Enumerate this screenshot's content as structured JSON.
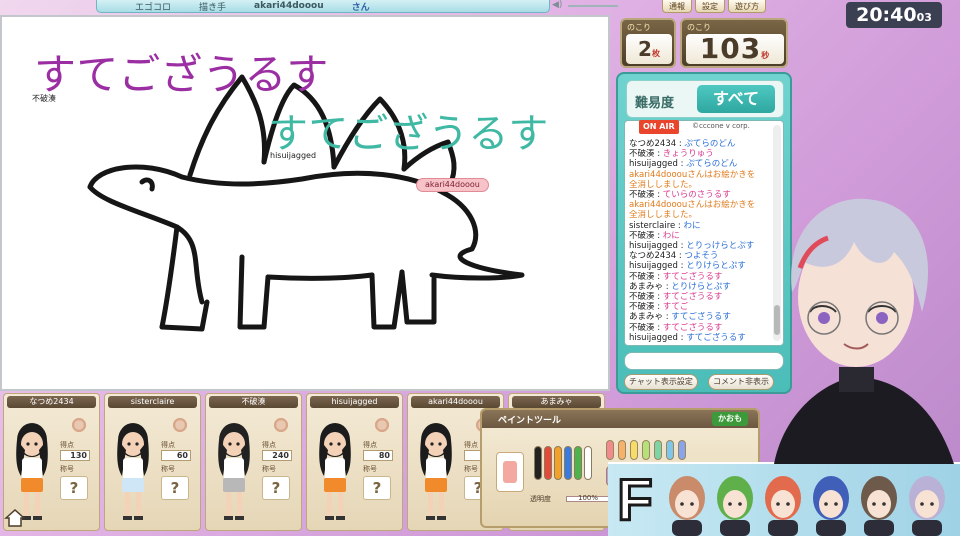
{
  "header": {
    "game_name": "エゴコロ",
    "role_label": "描き手",
    "drawer_name": "akari44dooou",
    "honorific": "さん",
    "buttons": [
      "通報",
      "設定",
      "遊び方"
    ]
  },
  "clock": {
    "hm": "20:40",
    "sec": "03"
  },
  "counters": {
    "remaining_label": "のこり",
    "remaining_sheets": "2",
    "sheets_unit": "枚",
    "remaining_time_label": "のこり",
    "remaining_seconds": "103",
    "seconds_unit": "秒"
  },
  "canvas": {
    "guess_purple": "すてござうるす",
    "guess_teal": "すてござうるす",
    "small_names": [
      "不破湊",
      "hisuijagged"
    ],
    "tag_name": "akari44dooou"
  },
  "chat": {
    "difficulty_label": "難易度",
    "difficulty_value": "すべて",
    "on_air": "ON AIR",
    "corp": "©cccone v corp.",
    "lines": [
      {
        "name": "なつめ2434",
        "msg": "ぷてらのどん",
        "kind": "blue"
      },
      {
        "name": "不破湊",
        "msg": "きょうりゅう",
        "kind": "pink"
      },
      {
        "name": "hisuijagged",
        "msg": "ぷてらのどん",
        "kind": "blue"
      },
      {
        "name": "",
        "msg": "akari44dooouさんはお絵かきを",
        "kind": "sys"
      },
      {
        "name": "",
        "msg": "全消ししました。",
        "kind": "sys"
      },
      {
        "name": "不破湊",
        "msg": "ていらのさうるす",
        "kind": "pink"
      },
      {
        "name": "",
        "msg": "akari44dooouさんはお絵かきを",
        "kind": "sys"
      },
      {
        "name": "",
        "msg": "全消ししました。",
        "kind": "sys"
      },
      {
        "name": "sisterclaire",
        "msg": "わに",
        "kind": "blue"
      },
      {
        "name": "不破湊",
        "msg": "わに",
        "kind": "pink"
      },
      {
        "name": "hisuijagged",
        "msg": "とりっけらとぷす",
        "kind": "blue"
      },
      {
        "name": "なつめ2434",
        "msg": "つよそう",
        "kind": "blue"
      },
      {
        "name": "hisuijagged",
        "msg": "とりけらとぷす",
        "kind": "blue"
      },
      {
        "name": "不破湊",
        "msg": "すてござうるす",
        "kind": "pink"
      },
      {
        "name": "あまみゃ",
        "msg": "とりけらとぷす",
        "kind": "blue"
      },
      {
        "name": "不破湊",
        "msg": "すてござうるす",
        "kind": "pink"
      },
      {
        "name": "不破湊",
        "msg": "すてご",
        "kind": "pink"
      },
      {
        "name": "あまみゃ",
        "msg": "すてござうるす",
        "kind": "blue"
      },
      {
        "name": "不破湊",
        "msg": "すてござうるす",
        "kind": "pink"
      },
      {
        "name": "hisuijagged",
        "msg": "すてござうるす",
        "kind": "blue"
      }
    ],
    "btn_display_settings": "チャット表示設定",
    "btn_comment_hide": "コメント非表示"
  },
  "players": [
    {
      "name": "なつめ2434",
      "score": "130",
      "outfit": "#f08a2a",
      "hair": "#1c1c1c"
    },
    {
      "name": "sisterclaire",
      "score": "60",
      "outfit": "#cfe6f6",
      "hair": "#1c1c1c"
    },
    {
      "name": "不破湊",
      "score": "240",
      "outfit": "#b8b8b8",
      "hair": "#222222"
    },
    {
      "name": "hisuijagged",
      "score": "80",
      "outfit": "#f08a2a",
      "hair": "#1c1c1c"
    },
    {
      "name": "akari44dooou",
      "score": "",
      "outfit": "#f08a2a",
      "hair": "#1c1c1c"
    },
    {
      "name": "あまみゃ",
      "score": "",
      "outfit": "#f08a2a",
      "hair": "#1c1c1c"
    }
  ],
  "player_labels": {
    "score": "得点",
    "title": "称号",
    "unknown": "?"
  },
  "paint": {
    "title": "ペイントツール",
    "tab": "かおも",
    "opacity_label": "透明度",
    "opacity_value": "100%",
    "pen_colors": [
      "#222222",
      "#e24a3a",
      "#f2a12a",
      "#3a7be0",
      "#4db34d",
      "#ffffff"
    ],
    "palette": [
      "#f28b8b",
      "#f4b26b",
      "#f6dd6a",
      "#b5e07a",
      "#7fd4a6",
      "#7fc6ea",
      "#8aa4ea",
      "#c39ae6",
      "#eb9ad2",
      "#d9c2a3",
      "#f5d5b8",
      "#cfcfcf",
      "#8c8c8c"
    ]
  },
  "team": {
    "letter": "F"
  }
}
